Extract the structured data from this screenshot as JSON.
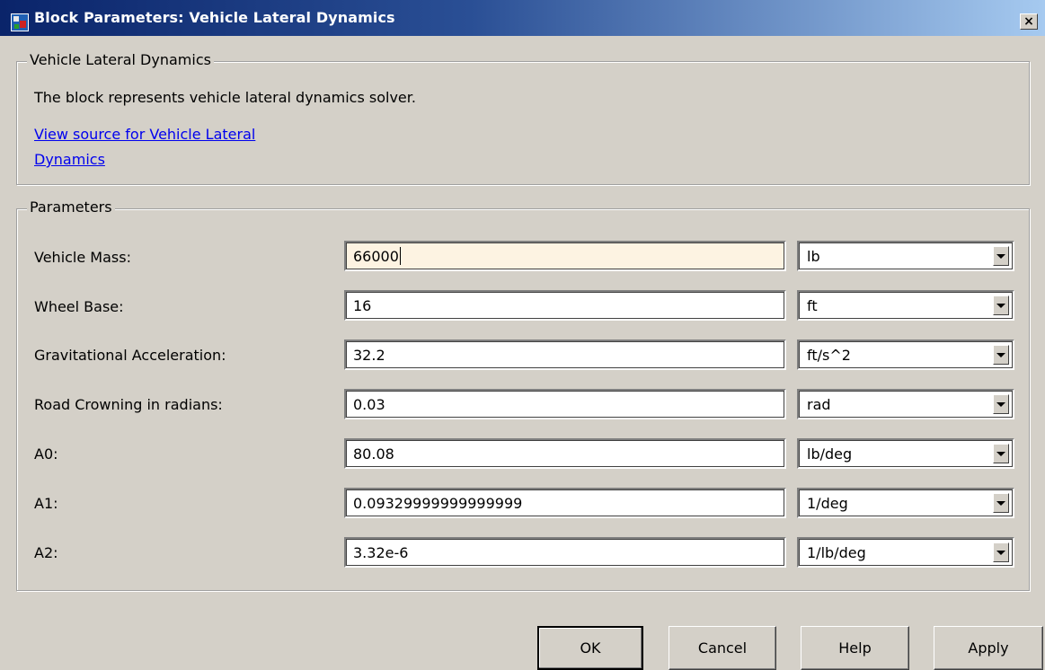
{
  "window": {
    "title": "Block Parameters: Vehicle Lateral Dynamics",
    "icon": "simulink-block-icon",
    "close_glyph": "×"
  },
  "description_group": {
    "legend": "Vehicle Lateral Dynamics",
    "text": "The block represents vehicle lateral dynamics solver.",
    "link_line1": "View source for Vehicle Lateral",
    "link_line2": "Dynamics"
  },
  "parameters_group": {
    "legend": "Parameters",
    "rows": [
      {
        "label": "Vehicle Mass:",
        "value": "66000",
        "unit": "lb"
      },
      {
        "label": "Wheel Base:",
        "value": "16",
        "unit": "ft"
      },
      {
        "label": "Gravitational Acceleration:",
        "value": "32.2",
        "unit": "ft/s^2"
      },
      {
        "label": "Road Crowning in radians:",
        "value": "0.03",
        "unit": "rad"
      },
      {
        "label": "A0:",
        "value": "80.08",
        "unit": "lb/deg"
      },
      {
        "label": "A1:",
        "value": "0.09329999999999999",
        "unit": "1/deg"
      },
      {
        "label": "A2:",
        "value": "3.32e-6",
        "unit": "1/lb/deg"
      }
    ]
  },
  "buttons": {
    "ok": "OK",
    "cancel": "Cancel",
    "help": "Help",
    "apply": "Apply"
  },
  "colors": {
    "titlebar_start": "#0a246a",
    "titlebar_end": "#a6caf0",
    "dialog_bg": "#d4d0c8",
    "link": "#0000ee",
    "active_field_bg": "#fdf3e2"
  }
}
